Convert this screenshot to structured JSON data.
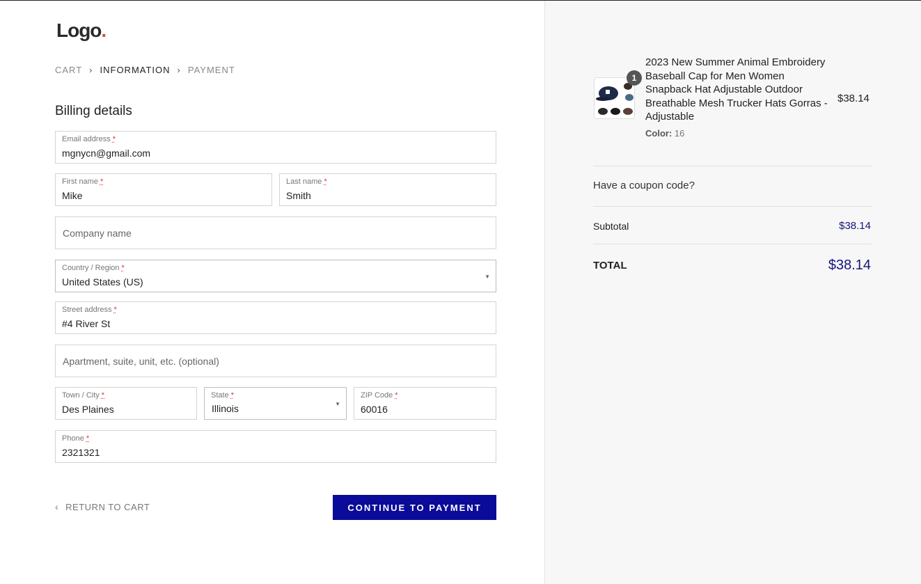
{
  "logo": {
    "text": "Logo",
    "dot": "."
  },
  "breadcrumb": [
    {
      "label": "CART",
      "active": false
    },
    {
      "label": "INFORMATION",
      "active": true
    },
    {
      "label": "PAYMENT",
      "active": false
    }
  ],
  "billing": {
    "title": "Billing details",
    "email": {
      "label": "Email address",
      "value": "mgnycn@gmail.com"
    },
    "first_name": {
      "label": "First name",
      "value": "Mike"
    },
    "last_name": {
      "label": "Last name",
      "value": "Smith"
    },
    "company": {
      "placeholder": "Company name"
    },
    "country": {
      "label": "Country / Region",
      "value": "United States (US)"
    },
    "street": {
      "label": "Street address",
      "value": "#4 River St"
    },
    "apartment": {
      "placeholder": "Apartment, suite, unit, etc. (optional)"
    },
    "city": {
      "label": "Town / City",
      "value": "Des Plaines"
    },
    "state": {
      "label": "State",
      "value": "Illinois"
    },
    "zip": {
      "label": "ZIP Code",
      "value": "60016"
    },
    "phone": {
      "label": "Phone",
      "value": "2321321"
    },
    "required_mark": "*"
  },
  "actions": {
    "return_label": "RETURN TO CART",
    "continue_label": "CONTINUE TO PAYMENT"
  },
  "order": {
    "item": {
      "name": "2023 New Summer Animal Embroidery Baseball Cap for Men Women Snapback Hat Adjustable Outdoor Breathable Mesh Trucker Hats Gorras - Adjustable",
      "color_label": "Color:",
      "color_value": "16",
      "price": "$38.14",
      "quantity": "1"
    },
    "coupon_label": "Have a coupon code?",
    "subtotal_label": "Subtotal",
    "subtotal_value": "$38.14",
    "total_label": "TOTAL",
    "total_value": "$38.14"
  },
  "colors": {
    "accent": "#0b0b99",
    "price_text": "#15157a",
    "logo_dot": "#e04848"
  }
}
